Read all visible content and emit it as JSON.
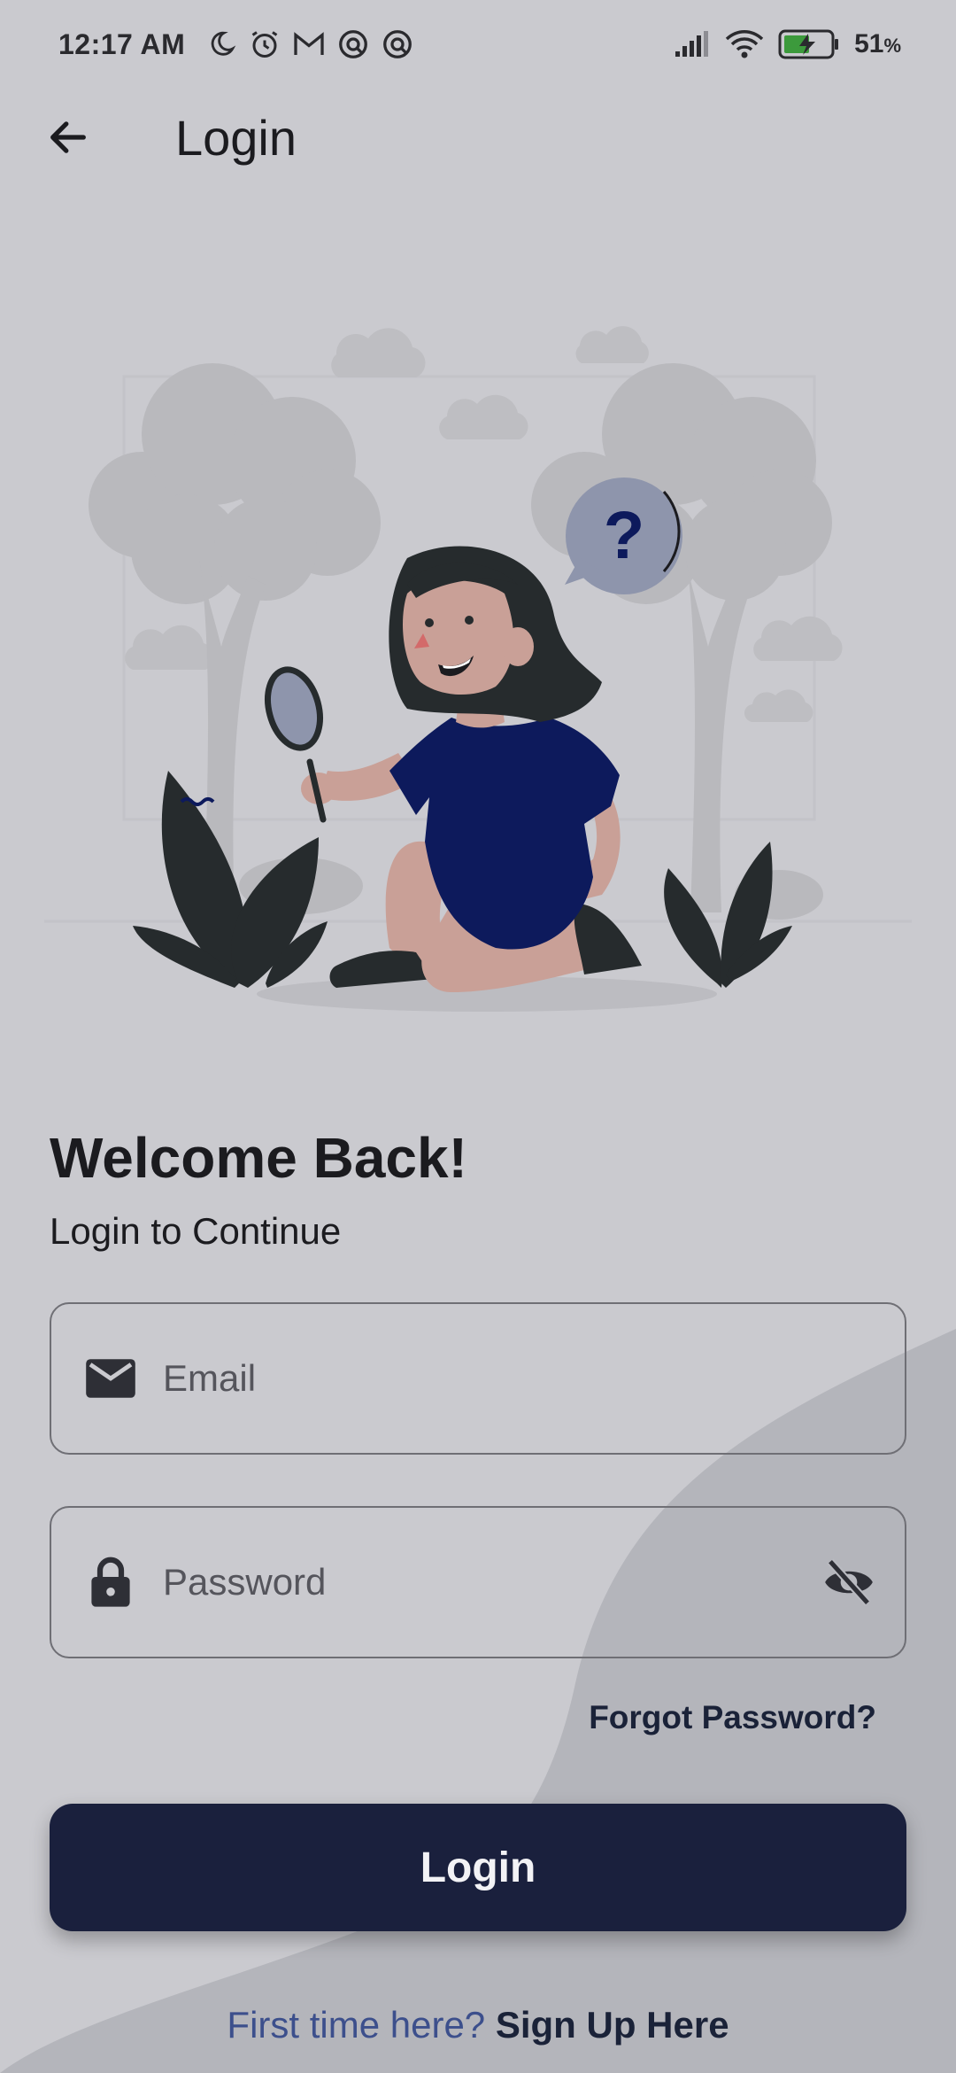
{
  "status_bar": {
    "time": "12:17 AM",
    "battery_percent": "51",
    "battery_unit": "%",
    "icons": [
      "moon-icon",
      "alarm-icon",
      "gmail-icon",
      "sync-icon",
      "sync-icon",
      "signal-icon",
      "wifi-icon",
      "battery-charging-icon"
    ]
  },
  "app_bar": {
    "title": "Login",
    "back_icon": "arrow-left-icon"
  },
  "illustration": {
    "question_mark": "?"
  },
  "welcome": {
    "title": "Welcome Back!",
    "subtitle": "Login to Continue"
  },
  "form": {
    "email_placeholder": "Email",
    "email_value": "",
    "password_placeholder": "Password",
    "password_value": "",
    "email_icon": "mail-icon",
    "password_icon": "lock-icon",
    "visibility_icon": "eye-off-icon",
    "forgot_password": "Forgot Password?",
    "login_button": "Login"
  },
  "signup": {
    "prompt": "First time here?",
    "link": "Sign Up Here"
  },
  "colors": {
    "background": "#cacacf",
    "wave": "#b4b5bb",
    "primary_button": "#1a203d",
    "link_dark": "#1a2238",
    "link_blue": "#3c4f8c",
    "dress": "#0d1a5c",
    "skin": "#c9a097",
    "hair": "#262b2d"
  }
}
